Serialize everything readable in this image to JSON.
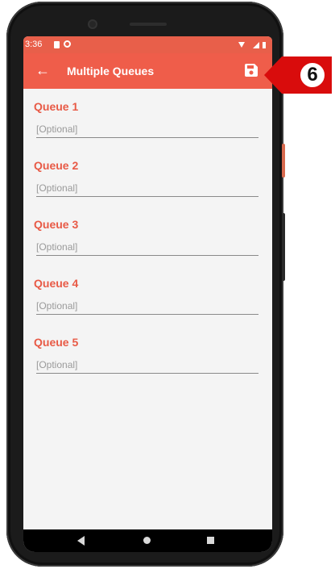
{
  "status_bar": {
    "time": "3:36"
  },
  "app_bar": {
    "title": "Multiple Queues",
    "back_icon": "arrow-left-icon",
    "save_icon": "floppy-disk-icon"
  },
  "queues": [
    {
      "label": "Queue 1",
      "value": "",
      "placeholder": "[Optional]"
    },
    {
      "label": "Queue 2",
      "value": "",
      "placeholder": "[Optional]"
    },
    {
      "label": "Queue 3",
      "value": "",
      "placeholder": "[Optional]"
    },
    {
      "label": "Queue 4",
      "value": "",
      "placeholder": "[Optional]"
    },
    {
      "label": "Queue 5",
      "value": "",
      "placeholder": "[Optional]"
    }
  ],
  "callout": {
    "number": "6"
  },
  "colors": {
    "app_bar": "#ef5d4a",
    "label": "#e85a46",
    "callout_red": "#d90c0c"
  }
}
